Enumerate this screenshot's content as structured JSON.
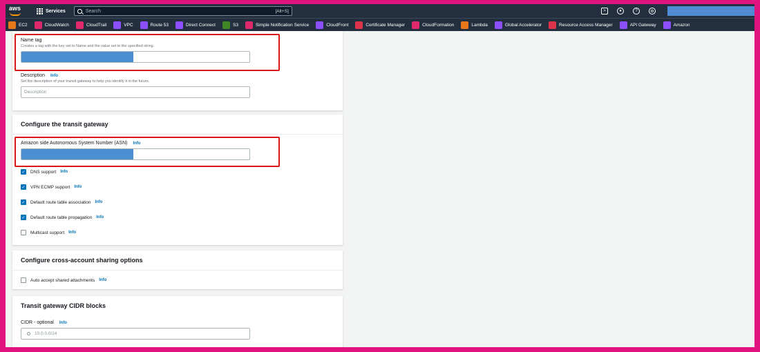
{
  "nav": {
    "logo": "aws",
    "services_label": "Services",
    "search_placeholder": "Search",
    "search_shortcut": "[Alt+S]",
    "icons": [
      "cloudshell-icon",
      "notifications-icon",
      "help-icon",
      "settings-icon"
    ]
  },
  "favorites": [
    {
      "label": "EC2",
      "color": "#e8761a"
    },
    {
      "label": "CloudWatch",
      "color": "#e0296b"
    },
    {
      "label": "CloudTrail",
      "color": "#e0296b"
    },
    {
      "label": "VPC",
      "color": "#8c4fff"
    },
    {
      "label": "Route 53",
      "color": "#8c4fff"
    },
    {
      "label": "Direct Connect",
      "color": "#8c4fff"
    },
    {
      "label": "S3",
      "color": "#3f8624"
    },
    {
      "label": "Simple Notification Service",
      "color": "#e0296b"
    },
    {
      "label": "CloudFront",
      "color": "#8c4fff"
    },
    {
      "label": "Certificate Manager",
      "color": "#dd344c"
    },
    {
      "label": "CloudFormation",
      "color": "#e0296b"
    },
    {
      "label": "Lambda",
      "color": "#e8761a"
    },
    {
      "label": "Global Accelerator",
      "color": "#8c4fff"
    },
    {
      "label": "Resource Access Manager",
      "color": "#dd344c"
    },
    {
      "label": "API Gateway",
      "color": "#8c4fff"
    },
    {
      "label": "Amazon",
      "color": "#8c4fff"
    }
  ],
  "details": {
    "name_tag_label": "Name tag",
    "name_tag_desc": "Creates a tag with the key set to Name and the value set to the specified string.",
    "description_label": "Description",
    "description_info": "Info",
    "description_desc": "Set the description of your transit gateway to help you identify it in the future.",
    "description_placeholder": "Description"
  },
  "configure": {
    "header": "Configure the transit gateway",
    "asn_label": "Amazon side Autonomous System Number (ASN)",
    "asn_info": "Info",
    "checkboxes": [
      {
        "label": "DNS support",
        "info": "Info",
        "checked": true
      },
      {
        "label": "VPN ECMP support",
        "info": "Info",
        "checked": true
      },
      {
        "label": "Default route table association",
        "info": "Info",
        "checked": true
      },
      {
        "label": "Default route table propagation",
        "info": "Info",
        "checked": true
      },
      {
        "label": "Multicast support",
        "info": "Info",
        "checked": false
      }
    ]
  },
  "sharing": {
    "header": "Configure cross-account sharing options",
    "auto_accept_label": "Auto accept shared attachments",
    "auto_accept_info": "Info",
    "auto_accept_checked": false
  },
  "cidr": {
    "header": "Transit gateway CIDR blocks",
    "label": "CIDR - optional",
    "info": "Info",
    "placeholder": "10.0.0.0/24"
  },
  "colors": {
    "highlight": "#d91515",
    "redacted_fill": "#4c8ed2",
    "link": "#0073bb"
  }
}
